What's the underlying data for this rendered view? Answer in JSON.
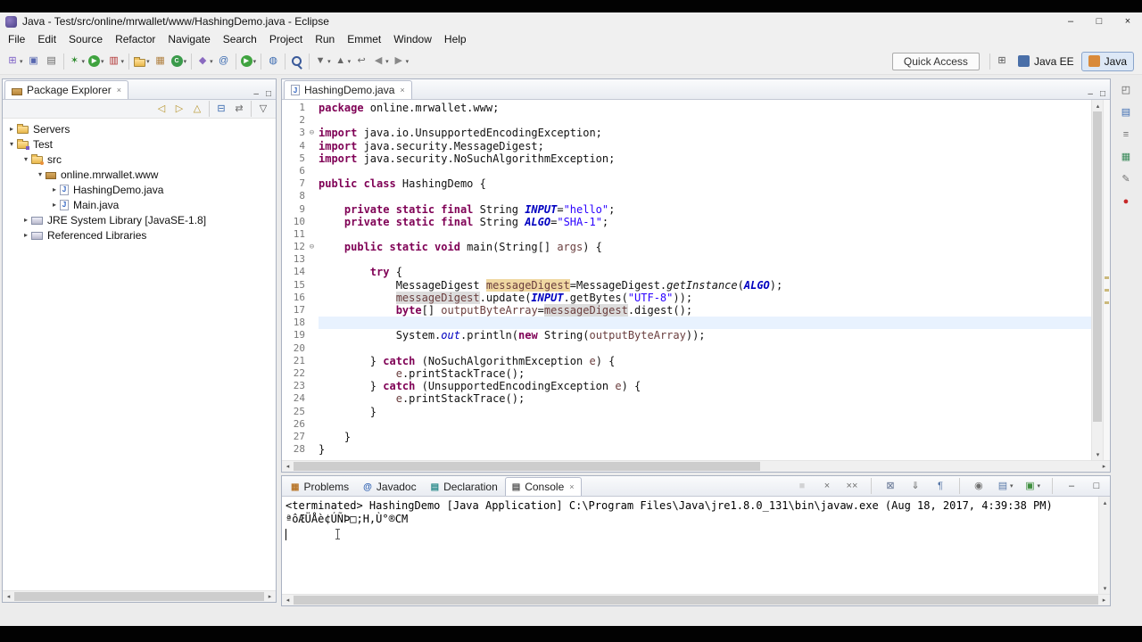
{
  "window": {
    "title": "Java - Test/src/online/mrwallet/www/HashingDemo.java - Eclipse"
  },
  "glyphs": {
    "minimize": "–",
    "maximize": "□",
    "close": "×",
    "dropdown": "▾",
    "tree_collapsed": "▸",
    "tree_expanded": "▾",
    "fold": "⊖",
    "scroll_left": "◂",
    "scroll_right": "▸",
    "scroll_up": "▴",
    "scroll_down": "▾",
    "java_file_letter": "J"
  },
  "menu": {
    "items": [
      "File",
      "Edit",
      "Source",
      "Refactor",
      "Navigate",
      "Search",
      "Project",
      "Run",
      "Emmet",
      "Window",
      "Help"
    ]
  },
  "toolbar": {
    "quick_access": "Quick Access",
    "open_perspective_glyph": "⊞",
    "buttons": [
      {
        "name": "new-wizard",
        "glyph": "⊞",
        "color": "#7a5cc5",
        "dd": true
      },
      {
        "name": "save",
        "glyph": "▣",
        "color": "#5868b0"
      },
      {
        "name": "print",
        "glyph": "▤",
        "color": "#666666"
      },
      {
        "sep": true
      },
      {
        "name": "debug",
        "glyph": "✶",
        "color": "#2e8b2e",
        "dd": true
      },
      {
        "name": "run",
        "shape": "circle",
        "bg": "#3fa33f",
        "glyph": "▶",
        "dd": true
      },
      {
        "name": "coverage",
        "glyph": "▥",
        "color": "#b03030",
        "dd": true
      },
      {
        "sep": true
      },
      {
        "name": "new-java-project",
        "shape": "folder",
        "dd": true
      },
      {
        "name": "new-java-package",
        "glyph": "▦",
        "color": "#b08040"
      },
      {
        "name": "new-java-class",
        "shape": "circle",
        "bg": "#3a9a4a",
        "glyph": "C",
        "dd": true
      },
      {
        "sep": true
      },
      {
        "name": "new-jar",
        "glyph": "◆",
        "color": "#8a6ac0",
        "dd": true
      },
      {
        "name": "javadoc-wizard",
        "glyph": "@",
        "color": "#3a6ab0"
      },
      {
        "sep": true
      },
      {
        "name": "external-tools",
        "shape": "circle",
        "bg": "#3fa33f",
        "glyph": "▶",
        "dd": true
      },
      {
        "sep": true
      },
      {
        "name": "open-web-browser",
        "glyph": "◍",
        "color": "#3a6ab0"
      },
      {
        "sep": true
      },
      {
        "name": "search",
        "shape": "mag"
      },
      {
        "sep": true
      },
      {
        "name": "next-annotation",
        "glyph": "▼",
        "color": "#666666",
        "dd": true
      },
      {
        "name": "previous-annotation",
        "glyph": "▲",
        "color": "#666666",
        "dd": true
      },
      {
        "name": "last-edit-location",
        "glyph": "↩",
        "color": "#666666"
      },
      {
        "name": "back",
        "glyph": "◀",
        "color": "#888888",
        "dd": true
      },
      {
        "name": "forward",
        "glyph": "▶",
        "color": "#888888",
        "dd": true
      }
    ],
    "perspectives": [
      {
        "label": "Java EE",
        "active": false,
        "icon_color": "#4a6fa8"
      },
      {
        "label": "Java",
        "active": true,
        "icon_color": "#d98a3a"
      }
    ]
  },
  "package_explorer": {
    "title": "Package Explorer",
    "toolbar": [
      {
        "name": "back",
        "glyph": "◁",
        "color": "#b8952e"
      },
      {
        "name": "forward",
        "glyph": "▷",
        "color": "#b8952e"
      },
      {
        "name": "up",
        "glyph": "△",
        "color": "#b8952e"
      },
      {
        "sep": true
      },
      {
        "name": "collapse-all",
        "glyph": "⊟",
        "color": "#3a6ab0"
      },
      {
        "name": "link-with-editor",
        "glyph": "⇄",
        "color": "#707070"
      },
      {
        "sep": true
      },
      {
        "name": "view-menu",
        "glyph": "▽",
        "color": "#555555"
      }
    ],
    "tree": [
      {
        "label": "Servers",
        "depth": 0,
        "arrow": "collapsed",
        "icon": "server-folder"
      },
      {
        "label": "Test",
        "depth": 0,
        "arrow": "expanded",
        "icon": "project"
      },
      {
        "label": "src",
        "depth": 1,
        "arrow": "expanded",
        "icon": "source-folder"
      },
      {
        "label": "online.mrwallet.www",
        "depth": 2,
        "arrow": "expanded",
        "icon": "package"
      },
      {
        "label": "HashingDemo.java",
        "depth": 3,
        "arrow": "collapsed",
        "icon": "java-file"
      },
      {
        "label": "Main.java",
        "depth": 3,
        "arrow": "collapsed",
        "icon": "java-file"
      },
      {
        "label": "JRE System Library [JavaSE-1.8]",
        "depth": 1,
        "arrow": "collapsed",
        "icon": "library"
      },
      {
        "label": "Referenced Libraries",
        "depth": 1,
        "arrow": "collapsed",
        "icon": "library"
      }
    ]
  },
  "editor": {
    "tab": "HashingDemo.java",
    "lines": [
      {
        "segs": [
          [
            "package",
            "k"
          ],
          [
            " online.mrwallet.www;",
            "d"
          ]
        ]
      },
      {
        "segs": []
      },
      {
        "fold": true,
        "segs": [
          [
            "import",
            "k"
          ],
          [
            " java.io.UnsupportedEncodingException;",
            "d"
          ]
        ]
      },
      {
        "segs": [
          [
            "import",
            "k"
          ],
          [
            " java.security.MessageDigest;",
            "d"
          ]
        ]
      },
      {
        "segs": [
          [
            "import",
            "k"
          ],
          [
            " java.security.NoSuchAlgorithmException;",
            "d"
          ]
        ]
      },
      {
        "segs": []
      },
      {
        "segs": [
          [
            "public class",
            "k"
          ],
          [
            " HashingDemo {",
            "d"
          ]
        ]
      },
      {
        "segs": []
      },
      {
        "segs": [
          [
            "\t",
            "d"
          ],
          [
            "private static final",
            "k"
          ],
          [
            " String ",
            "d"
          ],
          [
            "INPUT",
            "c"
          ],
          [
            "=",
            "d"
          ],
          [
            "\"hello\"",
            "s"
          ],
          [
            ";",
            "d"
          ]
        ]
      },
      {
        "segs": [
          [
            "\t",
            "d"
          ],
          [
            "private static final",
            "k"
          ],
          [
            " String ",
            "d"
          ],
          [
            "ALGO",
            "c"
          ],
          [
            "=",
            "d"
          ],
          [
            "\"SHA-1\"",
            "s"
          ],
          [
            ";",
            "d"
          ]
        ]
      },
      {
        "segs": []
      },
      {
        "fold": true,
        "segs": [
          [
            "\t",
            "d"
          ],
          [
            "public static void",
            "k"
          ],
          [
            " main(String[] ",
            "d"
          ],
          [
            "args",
            "p"
          ],
          [
            ") {",
            "d"
          ]
        ]
      },
      {
        "segs": []
      },
      {
        "segs": [
          [
            "\t\t",
            "d"
          ],
          [
            "try",
            "k"
          ],
          [
            " {",
            "d"
          ]
        ]
      },
      {
        "segs": [
          [
            "\t\t\t",
            "d"
          ],
          [
            "MessageDigest ",
            "d"
          ],
          [
            "messageDigest",
            "v o1"
          ],
          [
            "=MessageDigest.",
            "d"
          ],
          [
            "getInstance",
            "m"
          ],
          [
            "(",
            "d"
          ],
          [
            "ALGO",
            "c"
          ],
          [
            ");",
            "d"
          ]
        ]
      },
      {
        "segs": [
          [
            "\t\t\t",
            "d"
          ],
          [
            "messageDigest",
            "v o2"
          ],
          [
            ".update(",
            "d"
          ],
          [
            "INPUT",
            "c"
          ],
          [
            ".getBytes(",
            "d"
          ],
          [
            "\"UTF-8\"",
            "s"
          ],
          [
            "));",
            "d"
          ]
        ]
      },
      {
        "segs": [
          [
            "\t\t\t",
            "d"
          ],
          [
            "byte",
            "k"
          ],
          [
            "[] ",
            "d"
          ],
          [
            "outputByteArray",
            "v"
          ],
          [
            "=",
            "d"
          ],
          [
            "messageDigest",
            "v o2"
          ],
          [
            ".digest();",
            "d"
          ]
        ]
      },
      {
        "cur": true,
        "segs": []
      },
      {
        "segs": [
          [
            "\t\t\t",
            "d"
          ],
          [
            "System.",
            "d"
          ],
          [
            "out",
            "f"
          ],
          [
            ".println(",
            "d"
          ],
          [
            "new",
            "k"
          ],
          [
            " String(",
            "d"
          ],
          [
            "outputByteArray",
            "v"
          ],
          [
            "));",
            "d"
          ]
        ]
      },
      {
        "segs": []
      },
      {
        "segs": [
          [
            "\t\t",
            "d"
          ],
          [
            "} ",
            "d"
          ],
          [
            "catch",
            "k"
          ],
          [
            " (NoSuchAlgorithmException ",
            "d"
          ],
          [
            "e",
            "p"
          ],
          [
            ") {",
            "d"
          ]
        ]
      },
      {
        "segs": [
          [
            "\t\t\t",
            "d"
          ],
          [
            "e",
            "v"
          ],
          [
            ".printStackTrace();",
            "d"
          ]
        ]
      },
      {
        "segs": [
          [
            "\t\t",
            "d"
          ],
          [
            "} ",
            "d"
          ],
          [
            "catch",
            "k"
          ],
          [
            " (UnsupportedEncodingException ",
            "d"
          ],
          [
            "e",
            "p"
          ],
          [
            ") {",
            "d"
          ]
        ]
      },
      {
        "segs": [
          [
            "\t\t\t",
            "d"
          ],
          [
            "e",
            "v"
          ],
          [
            ".printStackTrace();",
            "d"
          ]
        ]
      },
      {
        "segs": [
          [
            "\t\t",
            "d"
          ],
          [
            "}",
            "d"
          ]
        ]
      },
      {
        "segs": []
      },
      {
        "segs": [
          [
            "\t}",
            "d"
          ]
        ]
      },
      {
        "segs": [
          [
            "}",
            "d"
          ]
        ]
      }
    ]
  },
  "console": {
    "tabs": [
      {
        "label": "Problems",
        "icon": "problems",
        "glyph": "▦",
        "color": "#b8762a",
        "active": false
      },
      {
        "label": "Javadoc",
        "icon": "javadoc",
        "glyph": "@",
        "color": "#2a5db0",
        "active": false
      },
      {
        "label": "Declaration",
        "icon": "declaration",
        "glyph": "▤",
        "color": "#2a8a8a",
        "active": false
      },
      {
        "label": "Console",
        "icon": "console",
        "glyph": "▤",
        "color": "#555555",
        "active": true
      }
    ],
    "toolbar": [
      {
        "name": "terminate",
        "glyph": "■",
        "color": "#b8b8b8",
        "disabled": true
      },
      {
        "name": "remove-launch",
        "glyph": "×",
        "color": "#707070"
      },
      {
        "name": "remove-all-terminated",
        "glyph": "××",
        "color": "#707070"
      },
      {
        "sep": true
      },
      {
        "name": "clear-console",
        "glyph": "⊠",
        "color": "#607090"
      },
      {
        "name": "scroll-lock",
        "glyph": "⇓",
        "color": "#707070"
      },
      {
        "name": "word-wrap",
        "glyph": "¶",
        "color": "#5878a8"
      },
      {
        "sep": true
      },
      {
        "name": "pin-console",
        "glyph": "◉",
        "color": "#707070"
      },
      {
        "name": "display-selected-console",
        "glyph": "▤",
        "color": "#5878a8",
        "dd": true
      },
      {
        "name": "open-console",
        "glyph": "▣",
        "color": "#3f8f3f",
        "dd": true
      },
      {
        "sep": true
      },
      {
        "name": "minimize-view",
        "glyph": "–",
        "color": "#444444"
      },
      {
        "name": "maximize-view",
        "glyph": "□",
        "color": "#444444"
      }
    ],
    "status_line": "<terminated> HashingDemo [Java Application] C:\\Program Files\\Java\\jre1.8.0_131\\bin\\javaw.exe (Aug 18, 2017, 4:39:38 PM)",
    "output": "ªôÆÜÅè¢ÚÑÞ□;H,Ù°®CM"
  },
  "right_strip": [
    {
      "name": "restore-views",
      "glyph": "◰",
      "color": "#555555"
    },
    {
      "name": "minimized-outline-view",
      "glyph": "▤",
      "color": "#3a6ab0"
    },
    {
      "name": "minimized-task-list-view",
      "glyph": "≡",
      "color": "#707070"
    },
    {
      "name": "minimized-snippets-view",
      "glyph": "▦",
      "color": "#3a8a5a"
    },
    {
      "name": "minimized-ant-view",
      "glyph": "✎",
      "color": "#707070"
    },
    {
      "name": "error-log-view",
      "glyph": "●",
      "color": "#c62828"
    }
  ],
  "colors": {
    "keyword": "#7f0055",
    "string": "#2a00ff",
    "constant": "#0000c0",
    "local_variable": "#6a3e3e",
    "occurrence": "#f0d8a2",
    "occurrence_alt": "#dcdcdc",
    "current_line": "#e8f2fe"
  }
}
